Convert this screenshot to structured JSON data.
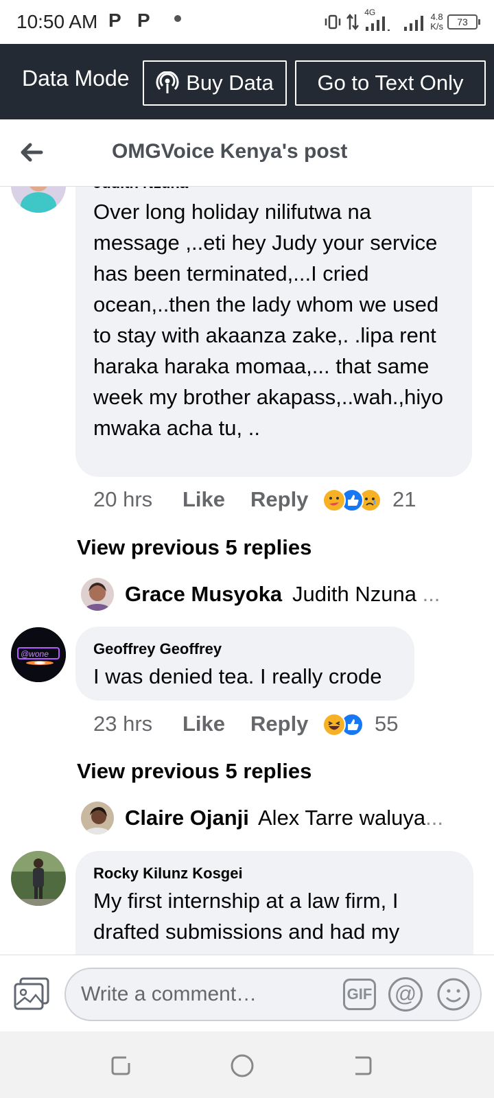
{
  "status_bar": {
    "time": "10:50 AM",
    "notif_icons": [
      "P",
      "P"
    ],
    "network": "4G",
    "speed_value": "4.8",
    "speed_unit": "K/s",
    "battery": "73"
  },
  "data_bar": {
    "label": "Data Mode",
    "buy_data": "Buy Data",
    "text_only": "Go to Text Only"
  },
  "header": {
    "title": "OMGVoice Kenya's post"
  },
  "comments": [
    {
      "name": "Judith Nzuna",
      "text": "Over long holiday nilifutwa na message ,..eti hey Judy your service has been terminated,...I cried ocean,..then the lady whom we used to stay with akaanza zake,. .lipa rent haraka haraka momaa,... that same week my brother akapass,..wah.,hiyo mwaka acha tu, ..",
      "time": "20 hrs",
      "like": "Like",
      "reply": "Reply",
      "reaction_count": "21",
      "reactions": [
        "care",
        "like",
        "sad"
      ],
      "view_previous": "View previous 5 replies",
      "latest_reply": {
        "name": "Grace Musyoka",
        "snippet": "Judith Nzuna",
        "ellipsis": "..."
      }
    },
    {
      "name": "Geoffrey Geoffrey",
      "text": "I was denied tea. I really crode",
      "time": "23 hrs",
      "like": "Like",
      "reply": "Reply",
      "reaction_count": "55",
      "reactions": [
        "haha",
        "like"
      ],
      "view_previous": "View previous 5 replies",
      "latest_reply": {
        "name": "Claire Ojanji",
        "snippet": "Alex Tarre waluya",
        "ellipsis": "..."
      }
    },
    {
      "name": "Rocky Kilunz Kosgei",
      "text": "My first internship at a law firm, I drafted submissions and had my"
    }
  ],
  "composer": {
    "placeholder": "Write a comment…",
    "gif": "GIF",
    "at": "@"
  },
  "colors": {
    "data_bar_bg": "#242a33",
    "bubble_bg": "#f0f2f5",
    "like_blue": "#1877f2",
    "meta_gray": "#65676b"
  }
}
